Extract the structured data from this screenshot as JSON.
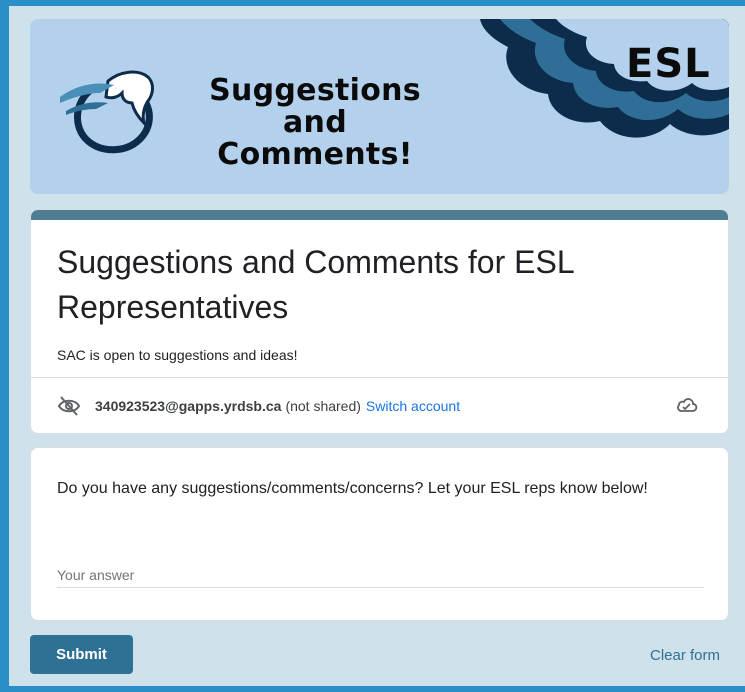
{
  "banner": {
    "title": "Suggestions and Comments!",
    "badge": "ESL",
    "logo_icon": "horse-logo-icon"
  },
  "form": {
    "title": "Suggestions and Comments for ESL Representatives",
    "description": "SAC is open to suggestions and ideas!"
  },
  "account": {
    "hidden_icon": "eye-off-icon",
    "email": "340923523@gapps.yrdsb.ca",
    "not_shared": "(not shared)",
    "switch_label": "Switch account",
    "cloud_icon": "cloud-saved-icon"
  },
  "question": {
    "text": "Do you have any suggestions/comments/concerns? Let your ESL reps know below!",
    "placeholder": "Your answer",
    "value": ""
  },
  "actions": {
    "submit_label": "Submit",
    "clear_label": "Clear form"
  },
  "colors": {
    "accent": "#2f7194",
    "banner_bg": "#b3d1ec",
    "page_bg": "#cfe1ea",
    "link": "#1a73e8"
  }
}
